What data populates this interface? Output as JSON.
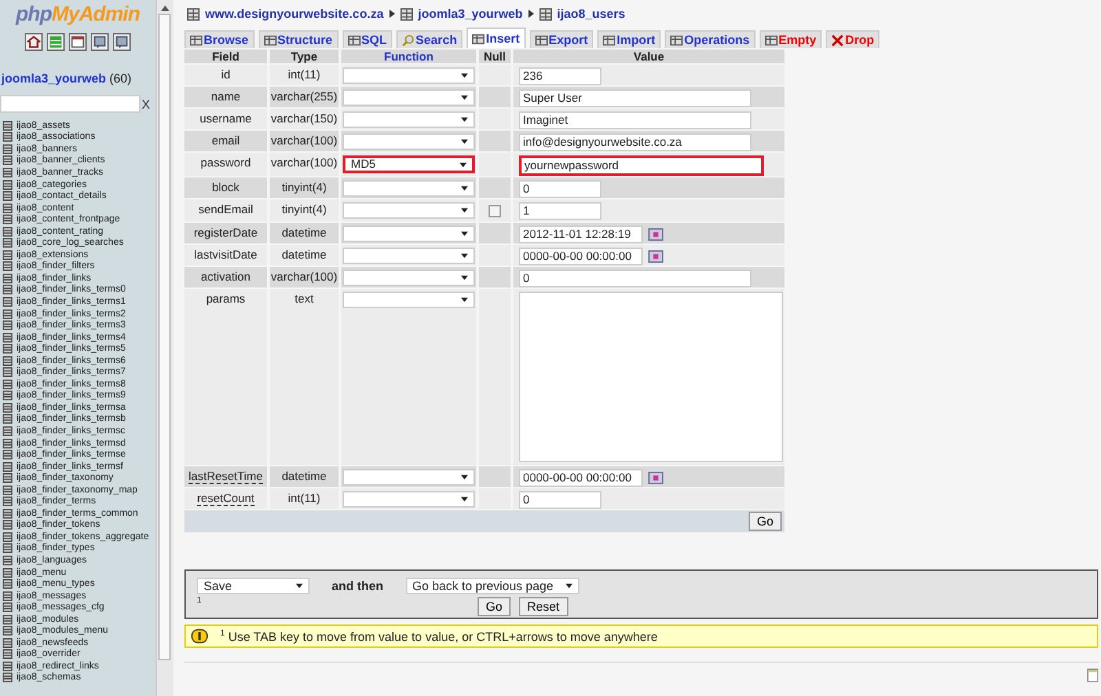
{
  "sidebar": {
    "logo": {
      "prefix": "php",
      "suffix": "MyAdmin"
    },
    "database": {
      "name": "joomla3_yourweb",
      "count": "(60)"
    },
    "filter": {
      "clear": "X"
    },
    "tables": [
      "ijao8_assets",
      "ijao8_associations",
      "ijao8_banners",
      "ijao8_banner_clients",
      "ijao8_banner_tracks",
      "ijao8_categories",
      "ijao8_contact_details",
      "ijao8_content",
      "ijao8_content_frontpage",
      "ijao8_content_rating",
      "ijao8_core_log_searches",
      "ijao8_extensions",
      "ijao8_finder_filters",
      "ijao8_finder_links",
      "ijao8_finder_links_terms0",
      "ijao8_finder_links_terms1",
      "ijao8_finder_links_terms2",
      "ijao8_finder_links_terms3",
      "ijao8_finder_links_terms4",
      "ijao8_finder_links_terms5",
      "ijao8_finder_links_terms6",
      "ijao8_finder_links_terms7",
      "ijao8_finder_links_terms8",
      "ijao8_finder_links_terms9",
      "ijao8_finder_links_termsa",
      "ijao8_finder_links_termsb",
      "ijao8_finder_links_termsc",
      "ijao8_finder_links_termsd",
      "ijao8_finder_links_termse",
      "ijao8_finder_links_termsf",
      "ijao8_finder_taxonomy",
      "ijao8_finder_taxonomy_map",
      "ijao8_finder_terms",
      "ijao8_finder_terms_common",
      "ijao8_finder_tokens",
      "ijao8_finder_tokens_aggregate",
      "ijao8_finder_types",
      "ijao8_languages",
      "ijao8_menu",
      "ijao8_menu_types",
      "ijao8_messages",
      "ijao8_messages_cfg",
      "ijao8_modules",
      "ijao8_modules_menu",
      "ijao8_newsfeeds",
      "ijao8_overrider",
      "ijao8_redirect_links",
      "ijao8_schemas"
    ]
  },
  "breadcrumb": [
    "www.designyourwebsite.co.za",
    "joomla3_yourweb",
    "ijao8_users"
  ],
  "tabs": [
    {
      "label": "Browse",
      "selected": false,
      "danger": false
    },
    {
      "label": "Structure",
      "selected": false,
      "danger": false
    },
    {
      "label": "SQL",
      "selected": false,
      "danger": false
    },
    {
      "label": "Search",
      "selected": false,
      "danger": false
    },
    {
      "label": "Insert",
      "selected": true,
      "danger": false
    },
    {
      "label": "Export",
      "selected": false,
      "danger": false
    },
    {
      "label": "Import",
      "selected": false,
      "danger": false
    },
    {
      "label": "Operations",
      "selected": false,
      "danger": false
    },
    {
      "label": "Empty",
      "selected": false,
      "danger": true
    },
    {
      "label": "Drop",
      "selected": false,
      "danger": true
    }
  ],
  "table": {
    "columns": [
      "Field",
      "Type",
      "Function",
      "Null",
      "Value"
    ],
    "rows": [
      {
        "field": "id",
        "type": "int(11)",
        "function": "",
        "value": "236",
        "kind": "short",
        "highlighted": false,
        "commented": false
      },
      {
        "field": "name",
        "type": "varchar(255)",
        "function": "",
        "value": "Super User",
        "kind": "long",
        "highlighted": false,
        "commented": false
      },
      {
        "field": "username",
        "type": "varchar(150)",
        "function": "",
        "value": "Imaginet",
        "kind": "long",
        "highlighted": false,
        "commented": false
      },
      {
        "field": "email",
        "type": "varchar(100)",
        "function": "",
        "value": "info@designyourwebsite.co.za",
        "kind": "long",
        "highlighted": false,
        "commented": false
      },
      {
        "field": "password",
        "type": "varchar(100)",
        "function": "MD5",
        "value": "yournewpassword",
        "kind": "long",
        "highlighted": true,
        "commented": false
      },
      {
        "field": "block",
        "type": "tinyint(4)",
        "function": "",
        "value": "0",
        "kind": "short",
        "highlighted": false,
        "commented": false
      },
      {
        "field": "sendEmail",
        "type": "tinyint(4)",
        "function": "",
        "value": "1",
        "kind": "short",
        "highlighted": false,
        "commented": false,
        "null": {
          "checked": false
        }
      },
      {
        "field": "registerDate",
        "type": "datetime",
        "function": "",
        "value": "2012-11-01 12:28:19",
        "kind": "date",
        "highlighted": false,
        "commented": false
      },
      {
        "field": "lastvisitDate",
        "type": "datetime",
        "function": "",
        "value": "0000-00-00 00:00:00",
        "kind": "date",
        "highlighted": false,
        "commented": false
      },
      {
        "field": "activation",
        "type": "varchar(100)",
        "function": "",
        "value": "0",
        "kind": "long",
        "highlighted": false,
        "commented": false
      },
      {
        "field": "params",
        "type": "text",
        "function": "",
        "kind": "textarea",
        "highlighted": false,
        "commented": false
      },
      {
        "field": "lastResetTime",
        "type": "datetime",
        "function": "",
        "value": "0000-00-00 00:00:00",
        "kind": "date",
        "highlighted": false,
        "commented": true
      },
      {
        "field": "resetCount",
        "type": "int(11)",
        "function": "",
        "value": "0",
        "kind": "short",
        "highlighted": false,
        "commented": true
      }
    ],
    "go": "Go"
  },
  "footer": {
    "action": "Save",
    "and_then": "and then",
    "footnote": "1",
    "after": "Go back to previous page",
    "go": "Go",
    "reset": "Reset"
  },
  "notice": {
    "mark": "1",
    "text": "Use TAB key to move from value to value, or CTRL+arrows to move anywhere"
  }
}
